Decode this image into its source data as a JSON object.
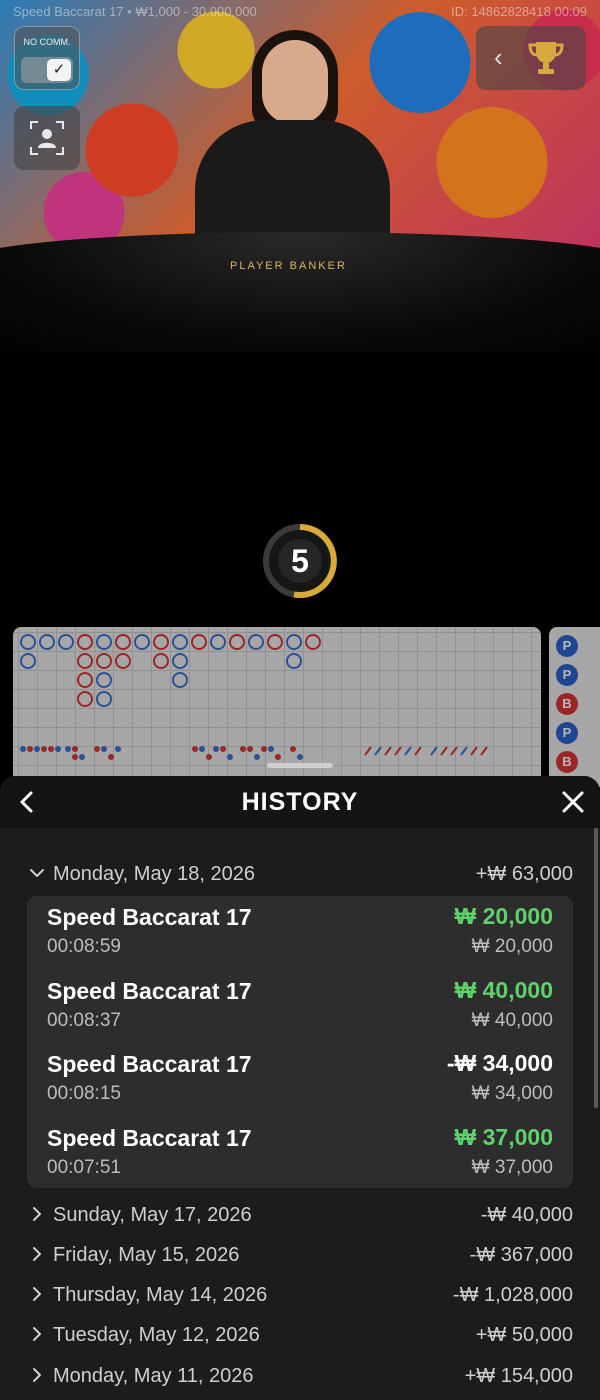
{
  "game_info": {
    "table_limits": "Speed Baccarat 17 • ₩1,000 - 30,000,000",
    "session_id": "ID: 14862828418 00:09"
  },
  "video": {
    "no_comm_label": "NO COMM.",
    "table_label": "PLAYER   BANKER"
  },
  "countdown": {
    "seconds": "5"
  },
  "roadmap": {
    "bead_badges": [
      "P",
      "P",
      "B",
      "P",
      "B"
    ]
  },
  "history": {
    "title": "HISTORY",
    "days": [
      {
        "date": "Monday, May 18, 2026",
        "total": "+₩ 63,000",
        "expanded": true,
        "bets": [
          {
            "game": "Speed Baccarat 17",
            "time": "00:08:59",
            "result": "₩ 20,000",
            "stake": "₩ 20,000",
            "outcome": "win"
          },
          {
            "game": "Speed Baccarat 17",
            "time": "00:08:37",
            "result": "₩ 40,000",
            "stake": "₩ 40,000",
            "outcome": "win"
          },
          {
            "game": "Speed Baccarat 17",
            "time": "00:08:15",
            "result": "-₩ 34,000",
            "stake": "₩ 34,000",
            "outcome": "loss"
          },
          {
            "game": "Speed Baccarat 17",
            "time": "00:07:51",
            "result": "₩ 37,000",
            "stake": "₩ 37,000",
            "outcome": "win"
          }
        ]
      },
      {
        "date": "Sunday, May 17, 2026",
        "total": "-₩ 40,000",
        "expanded": false
      },
      {
        "date": "Friday, May 15, 2026",
        "total": "-₩ 367,000",
        "expanded": false
      },
      {
        "date": "Thursday, May 14, 2026",
        "total": "-₩ 1,028,000",
        "expanded": false
      },
      {
        "date": "Tuesday, May 12, 2026",
        "total": "+₩ 50,000",
        "expanded": false
      },
      {
        "date": "Monday, May 11, 2026",
        "total": "+₩ 154,000",
        "expanded": false
      }
    ]
  },
  "colors": {
    "win": "#5fd16b",
    "loss": "#ffffff",
    "player": "#2b63c9",
    "banker": "#d93535",
    "countdown_ring": "#d9a93a"
  }
}
